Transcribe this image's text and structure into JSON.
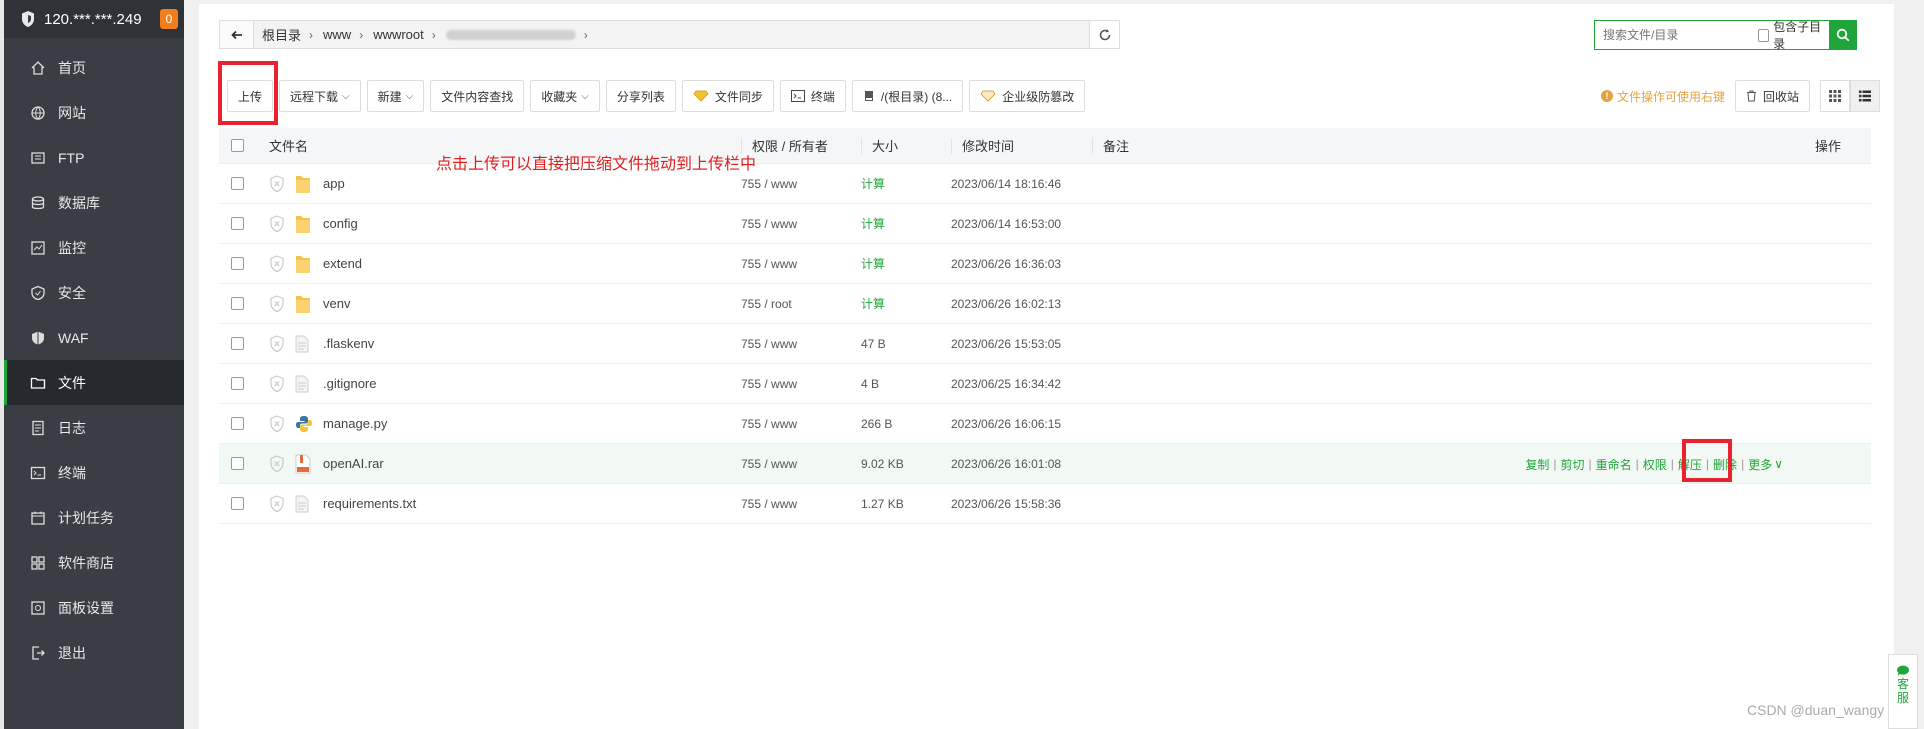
{
  "server": {
    "ip": "120.***.***.249",
    "badge": "0"
  },
  "sidebar": {
    "items": [
      {
        "label": "首页",
        "icon": "home-icon"
      },
      {
        "label": "网站",
        "icon": "globe-icon"
      },
      {
        "label": "FTP",
        "icon": "ftp-icon"
      },
      {
        "label": "数据库",
        "icon": "database-icon"
      },
      {
        "label": "监控",
        "icon": "monitor-icon"
      },
      {
        "label": "安全",
        "icon": "shield-icon"
      },
      {
        "label": "WAF",
        "icon": "waf-icon"
      },
      {
        "label": "文件",
        "icon": "folder-icon",
        "active": true
      },
      {
        "label": "日志",
        "icon": "log-icon"
      },
      {
        "label": "终端",
        "icon": "terminal-icon"
      },
      {
        "label": "计划任务",
        "icon": "calendar-icon"
      },
      {
        "label": "软件商店",
        "icon": "apps-icon"
      },
      {
        "label": "面板设置",
        "icon": "settings-icon"
      },
      {
        "label": "退出",
        "icon": "logout-icon"
      }
    ]
  },
  "path": {
    "crumbs": [
      "根目录",
      "www",
      "wwwroot"
    ],
    "refresh_icon": "refresh-icon",
    "back_icon": "arrow-left-icon"
  },
  "search": {
    "placeholder": "搜索文件/目录",
    "include_sub": "包含子目录"
  },
  "toolbar": {
    "upload": "上传",
    "remote_download": "远程下载",
    "new": "新建",
    "content_search": "文件内容查找",
    "favorites": "收藏夹",
    "share_list": "分享列表",
    "file_sync": "文件同步",
    "terminal": "终端",
    "disk": "/(根目录) (8...",
    "tamper": "企业级防篡改",
    "tip": "文件操作可使用右键",
    "recycle": "回收站"
  },
  "table": {
    "headers": {
      "name": "文件名",
      "perm": "权限 / 所有者",
      "size": "大小",
      "mtime": "修改时间",
      "note": "备注",
      "ops": "操作"
    },
    "rows": [
      {
        "name": "app",
        "type": "folder",
        "perm": "755 / www",
        "size": "计算",
        "mtime": "2023/06/14 18:16:46"
      },
      {
        "name": "config",
        "type": "folder",
        "perm": "755 / www",
        "size": "计算",
        "mtime": "2023/06/14 16:53:00"
      },
      {
        "name": "extend",
        "type": "folder",
        "perm": "755 / www",
        "size": "计算",
        "mtime": "2023/06/26 16:36:03"
      },
      {
        "name": "venv",
        "type": "folder",
        "perm": "755 / root",
        "size": "计算",
        "mtime": "2023/06/26 16:02:13"
      },
      {
        "name": ".flaskenv",
        "type": "file",
        "perm": "755 / www",
        "size": "47 B",
        "mtime": "2023/06/26 15:53:05"
      },
      {
        "name": ".gitignore",
        "type": "file",
        "perm": "755 / www",
        "size": "4 B",
        "mtime": "2023/06/25 16:34:42"
      },
      {
        "name": "manage.py",
        "type": "python",
        "perm": "755 / www",
        "size": "266 B",
        "mtime": "2023/06/26 16:06:15"
      },
      {
        "name": "openAI.rar",
        "type": "rar",
        "perm": "755 / www",
        "size": "9.02 KB",
        "mtime": "2023/06/26 16:01:08"
      },
      {
        "name": "requirements.txt",
        "type": "file",
        "perm": "755 / www",
        "size": "1.27 KB",
        "mtime": "2023/06/26 15:58:36"
      }
    ],
    "row_ops": [
      "复制",
      "剪切",
      "重命名",
      "权限",
      "解压",
      "删除",
      "更多"
    ]
  },
  "annotation": {
    "note": "点击上传可以直接把压缩文件拖动到上传栏中"
  },
  "watermark": "CSDN @duan_wangy",
  "kefu": [
    "客",
    "服"
  ],
  "colors": {
    "accent": "#20a53a",
    "sidebar": "#3a3d43",
    "annotation": "#e8232f",
    "tip": "#e6a23c"
  }
}
